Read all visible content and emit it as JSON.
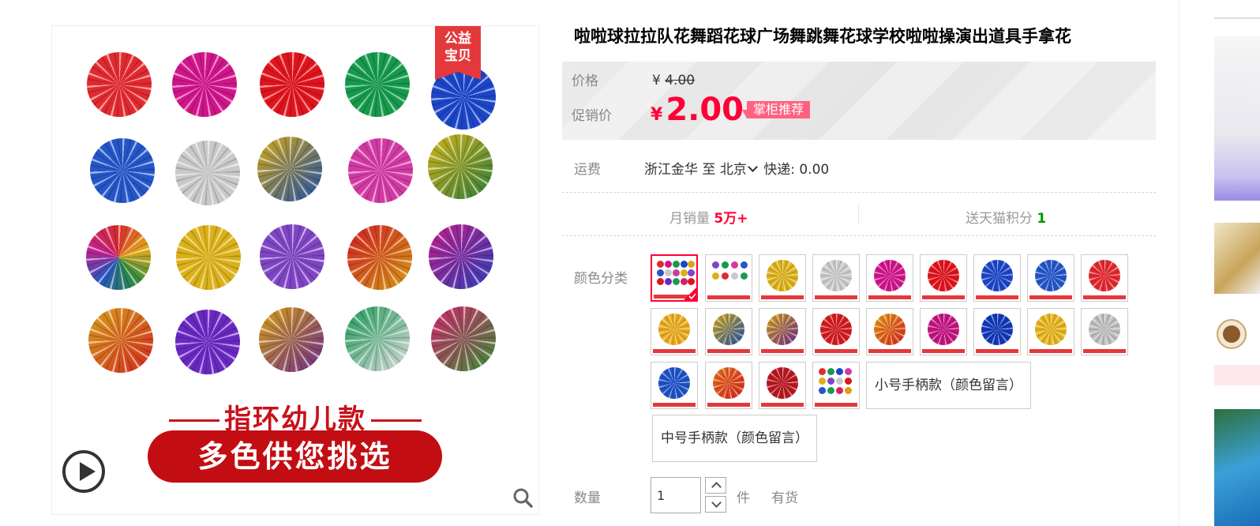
{
  "product": {
    "title": "啦啦球拉拉队花舞蹈花球广场舞跳舞花球学校啦啦操演出道具手拿花",
    "charity_badge": [
      "公益",
      "宝贝"
    ],
    "banner_line": "指环幼儿款",
    "banner_pill": "多色供您挑选"
  },
  "colors": {
    "accent": "#ff0036",
    "badge_red": "#e4393c",
    "recommend_pink": "#ff6281",
    "points_green": "#009900"
  },
  "price": {
    "label": "价格",
    "yen": "¥",
    "original": "4.00",
    "promo_label": "促销价",
    "promo": "2.00",
    "recommend_tag": "掌柜推荐"
  },
  "shipping": {
    "label": "运费",
    "from": "浙江金华",
    "to_word": "至",
    "to_city": "北京",
    "method": "快递:",
    "fee": "0.00"
  },
  "stats": {
    "monthly_sales_label": "月销量",
    "monthly_sales_value": "5万+",
    "points_label": "送天猫积分",
    "points_value": "1"
  },
  "sku": {
    "label": "颜色分类",
    "text_options": [
      "小号手柄款（颜色留言）",
      "中号手柄款（颜色留言）"
    ]
  },
  "quantity": {
    "label": "数量",
    "value": "1",
    "unit": "件",
    "stock": "有货"
  },
  "icons": [
    "play-icon",
    "zoom-icon",
    "chevron-down-icon",
    "check-icon",
    "chevron-up-icon"
  ]
}
